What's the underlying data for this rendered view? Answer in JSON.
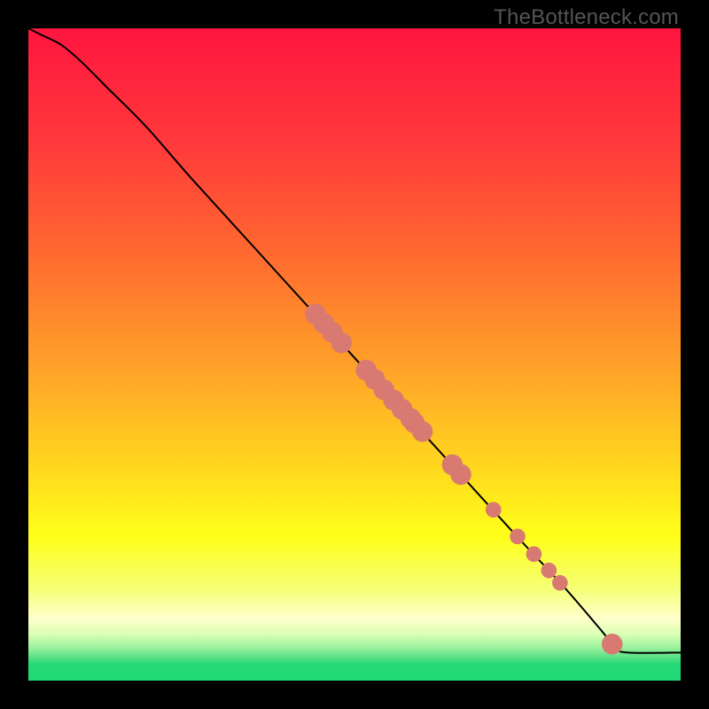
{
  "watermark": "TheBottleneck.com",
  "colors": {
    "frame": "#000000",
    "curve": "#000000",
    "point_fill": "#d97a72",
    "point_stroke": "#d97a72",
    "gradient_stops": [
      {
        "offset": 0.0,
        "color": "#ff153f"
      },
      {
        "offset": 0.18,
        "color": "#ff3a3b"
      },
      {
        "offset": 0.35,
        "color": "#ff6b2f"
      },
      {
        "offset": 0.52,
        "color": "#ffa229"
      },
      {
        "offset": 0.66,
        "color": "#ffd31f"
      },
      {
        "offset": 0.78,
        "color": "#ffff1a"
      },
      {
        "offset": 0.86,
        "color": "#f5ff77"
      },
      {
        "offset": 0.905,
        "color": "#ffffcc"
      },
      {
        "offset": 0.93,
        "color": "#d7ffb3"
      },
      {
        "offset": 0.95,
        "color": "#99f29d"
      },
      {
        "offset": 0.965,
        "color": "#55e085"
      },
      {
        "offset": 0.975,
        "color": "#26d977"
      },
      {
        "offset": 1.0,
        "color": "#1fd874"
      }
    ]
  },
  "chart_data": {
    "type": "line",
    "title": "",
    "xlabel": "",
    "ylabel": "",
    "xlim": [
      0,
      100
    ],
    "ylim": [
      0,
      100
    ],
    "grid": false,
    "legend": false,
    "series": [
      {
        "name": "curve",
        "x": [
          0,
          2,
          5,
          8,
          12,
          18,
          25,
          35,
          45,
          55,
          65,
          75,
          82,
          88,
          90,
          92,
          100
        ],
        "y": [
          100,
          99,
          97.5,
          95,
          91,
          85,
          77,
          66,
          55,
          44,
          33,
          22,
          14.5,
          7.5,
          5,
          4.3,
          4.3
        ]
      }
    ],
    "points": [
      {
        "x": 44.0,
        "y": 56.2,
        "r": 1.6
      },
      {
        "x": 45.3,
        "y": 54.8,
        "r": 1.6
      },
      {
        "x": 46.6,
        "y": 53.4,
        "r": 1.6
      },
      {
        "x": 48.0,
        "y": 51.8,
        "r": 1.6
      },
      {
        "x": 51.8,
        "y": 47.6,
        "r": 1.6
      },
      {
        "x": 53.1,
        "y": 46.2,
        "r": 1.6
      },
      {
        "x": 54.5,
        "y": 44.6,
        "r": 1.6
      },
      {
        "x": 56.0,
        "y": 43.0,
        "r": 1.6
      },
      {
        "x": 57.3,
        "y": 41.6,
        "r": 1.6
      },
      {
        "x": 58.6,
        "y": 40.2,
        "r": 1.6
      },
      {
        "x": 59.2,
        "y": 39.5,
        "r": 1.6
      },
      {
        "x": 60.4,
        "y": 38.2,
        "r": 1.6
      },
      {
        "x": 65.0,
        "y": 33.1,
        "r": 1.6
      },
      {
        "x": 66.3,
        "y": 31.6,
        "r": 1.6
      },
      {
        "x": 71.3,
        "y": 26.2,
        "r": 1.2
      },
      {
        "x": 75.0,
        "y": 22.1,
        "r": 1.2
      },
      {
        "x": 77.5,
        "y": 19.4,
        "r": 1.2
      },
      {
        "x": 79.8,
        "y": 16.9,
        "r": 1.2
      },
      {
        "x": 81.5,
        "y": 15.0,
        "r": 1.2
      },
      {
        "x": 89.5,
        "y": 5.6,
        "r": 1.6
      }
    ]
  }
}
